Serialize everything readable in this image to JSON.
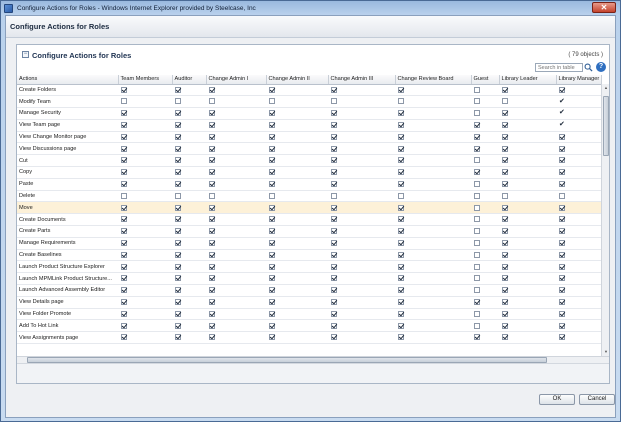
{
  "window": {
    "title": "Configure Actions for Roles - Windows Internet Explorer provided by Steelcase, Inc",
    "close_label": "✕"
  },
  "page": {
    "heading": "Configure Actions for Roles"
  },
  "panel": {
    "title": "Configure Actions for Roles",
    "object_count": "( 79 objects )",
    "search_placeholder": "Search in table",
    "help_label": "?",
    "collapse_label": "−"
  },
  "table": {
    "columns": [
      "Actions",
      "Team Members",
      "Auditor",
      "Change Admin I",
      "Change Admin II",
      "Change Admin III",
      "Change Review Board",
      "Guest",
      "Library Leader",
      "Library Manager"
    ],
    "rows": [
      {
        "action": "Create Folders",
        "cells": [
          "on",
          "on",
          "on",
          "on",
          "on",
          "on",
          "off",
          "on",
          "on"
        ]
      },
      {
        "action": "Modify Team",
        "cells": [
          "off",
          "off",
          "off",
          "off",
          "off",
          "off",
          "off",
          "off",
          "tick"
        ]
      },
      {
        "action": "Manage Security",
        "cells": [
          "on",
          "on",
          "on",
          "on",
          "on",
          "on",
          "off",
          "on",
          "tick"
        ]
      },
      {
        "action": "View Team page",
        "cells": [
          "on",
          "on",
          "on",
          "on",
          "on",
          "on",
          "on",
          "on",
          "tick"
        ]
      },
      {
        "action": "View Change Monitor page",
        "cells": [
          "on",
          "on",
          "on",
          "on",
          "on",
          "on",
          "on",
          "on",
          "on"
        ]
      },
      {
        "action": "View Discussions page",
        "cells": [
          "on",
          "on",
          "on",
          "on",
          "on",
          "on",
          "on",
          "on",
          "on"
        ]
      },
      {
        "action": "Cut",
        "cells": [
          "on",
          "on",
          "on",
          "on",
          "on",
          "on",
          "off",
          "on",
          "on"
        ]
      },
      {
        "action": "Copy",
        "cells": [
          "on",
          "on",
          "on",
          "on",
          "on",
          "on",
          "on",
          "on",
          "on"
        ]
      },
      {
        "action": "Paste",
        "cells": [
          "on",
          "on",
          "on",
          "on",
          "on",
          "on",
          "off",
          "on",
          "on"
        ]
      },
      {
        "action": "Delete",
        "cells": [
          "off",
          "off",
          "off",
          "off",
          "off",
          "off",
          "off",
          "off",
          "off"
        ]
      },
      {
        "action": "Move",
        "cells": [
          "on",
          "on",
          "on",
          "on",
          "on",
          "on",
          "off",
          "on",
          "on"
        ],
        "highlight": true
      },
      {
        "action": "Create Documents",
        "cells": [
          "on",
          "on",
          "on",
          "on",
          "on",
          "on",
          "off",
          "on",
          "on"
        ]
      },
      {
        "action": "Create Parts",
        "cells": [
          "on",
          "on",
          "on",
          "on",
          "on",
          "on",
          "off",
          "on",
          "on"
        ]
      },
      {
        "action": "Manage Requirements",
        "cells": [
          "on",
          "on",
          "on",
          "on",
          "on",
          "on",
          "off",
          "on",
          "on"
        ]
      },
      {
        "action": "Create Baselines",
        "cells": [
          "on",
          "on",
          "on",
          "on",
          "on",
          "on",
          "off",
          "on",
          "on"
        ]
      },
      {
        "action": "Launch Product Structure Explorer",
        "cells": [
          "on",
          "on",
          "on",
          "on",
          "on",
          "on",
          "off",
          "on",
          "on"
        ]
      },
      {
        "action": "Launch MPMLink Product Structure...",
        "cells": [
          "on",
          "on",
          "on",
          "on",
          "on",
          "on",
          "off",
          "on",
          "on"
        ]
      },
      {
        "action": "Launch Advanced Assembly Editor",
        "cells": [
          "on",
          "on",
          "on",
          "on",
          "on",
          "on",
          "off",
          "on",
          "on"
        ]
      },
      {
        "action": "View Details page",
        "cells": [
          "on",
          "on",
          "on",
          "on",
          "on",
          "on",
          "on",
          "on",
          "on"
        ]
      },
      {
        "action": "View Folder Promote",
        "cells": [
          "on",
          "on",
          "on",
          "on",
          "on",
          "on",
          "off",
          "on",
          "on"
        ]
      },
      {
        "action": "Add To Hot Link",
        "cells": [
          "on",
          "on",
          "on",
          "on",
          "on",
          "on",
          "off",
          "on",
          "on"
        ]
      },
      {
        "action": "View Assignments page",
        "cells": [
          "on",
          "on",
          "on",
          "on",
          "on",
          "on",
          "on",
          "on",
          "on"
        ]
      }
    ]
  },
  "buttons": {
    "ok": "OK",
    "cancel": "Cancel"
  },
  "colors": {
    "highlight_row": "#fdf1d8",
    "help": "#2f6fc0"
  }
}
